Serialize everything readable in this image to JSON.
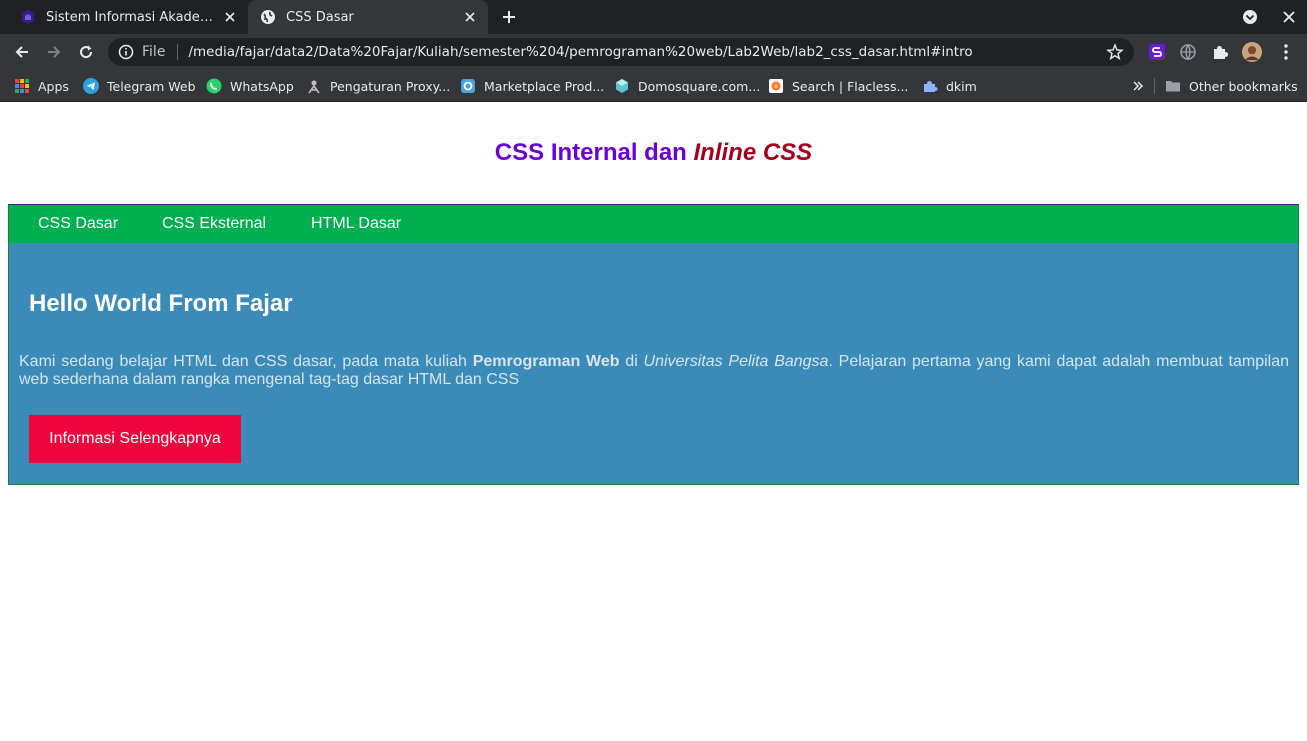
{
  "browser": {
    "tabs": [
      {
        "title": "Sistem Informasi Akademik",
        "favicon": "academic-icon"
      },
      {
        "title": "CSS Dasar",
        "favicon": "globe-icon"
      }
    ],
    "address_bar": {
      "scheme_label": "File",
      "url": "/media/fajar/data2/Data%20Fajar/Kuliah/semester%204/pemrograman%20web/Lab2Web/lab2_css_dasar.html#intro"
    },
    "bookmarks": [
      {
        "label": "Apps",
        "icon": "apps-grid-icon"
      },
      {
        "label": "Telegram Web",
        "icon": "telegram-icon"
      },
      {
        "label": "WhatsApp",
        "icon": "whatsapp-icon"
      },
      {
        "label": "Pengaturan Proxy...",
        "icon": "proxy-icon"
      },
      {
        "label": "Marketplace Prod...",
        "icon": "marketplace-icon"
      },
      {
        "label": "Domosquare.com...",
        "icon": "domosquare-icon"
      },
      {
        "label": "Search | Flacless...",
        "icon": "flacless-icon"
      },
      {
        "label": "dkim",
        "icon": "puzzle-icon"
      }
    ],
    "other_bookmarks": "Other bookmarks"
  },
  "page": {
    "title_plain": "CSS Internal dan ",
    "title_italic": "Inline CSS",
    "nav": [
      "CSS Dasar",
      "CSS Eksternal",
      "HTML Dasar"
    ],
    "intro": {
      "heading": "Hello World From Fajar",
      "text_1": "Kami sedang belajar HTML dan CSS dasar, pada mata kuliah ",
      "bold": "Pemrograman Web",
      "text_2": " di ",
      "italic": "Universitas Pelita Bangsa",
      "text_3": ". Pelajaran pertama yang kami dapat adalah membuat tampilan web sederhana dalam rangka mengenal tag-tag dasar HTML dan CSS",
      "button": "Informasi Selengkapnya"
    }
  },
  "colors": {
    "title_purple": "#6b00d7",
    "title_italic_red": "#a3001b",
    "nav_green": "#00b050",
    "intro_blue": "#3b8bb8",
    "button_red": "#f0043c"
  }
}
